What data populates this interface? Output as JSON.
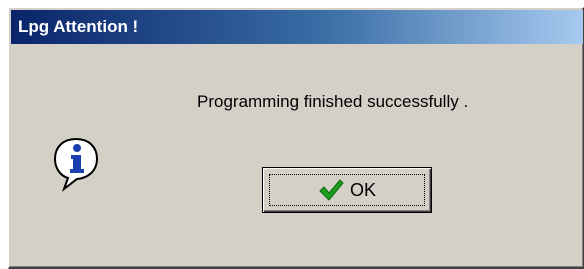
{
  "window": {
    "title": "Lpg Attention !"
  },
  "message": {
    "text": "Programming finished successfully ."
  },
  "icon": {
    "name": "information-icon",
    "color": "#1a3fb0"
  },
  "ok_button": {
    "label": "OK",
    "icon": "checkmark-icon",
    "icon_color": "#1e9e1e"
  }
}
